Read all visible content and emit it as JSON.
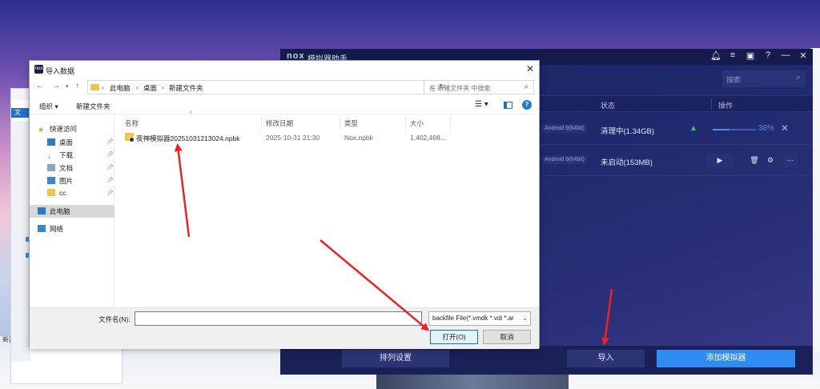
{
  "desktop": {
    "fragment_text": "新建"
  },
  "bg_explorer": {
    "tab_label": "文"
  },
  "nox": {
    "logo": "nox",
    "title": "模拟器助手",
    "title_icons": [
      "bell-icon",
      "menu-icon",
      "folder-icon",
      "help-icon",
      "minimize-icon",
      "close-icon"
    ],
    "search_placeholder": "搜索",
    "columns": {
      "status": "状态",
      "actions": "操作"
    },
    "rows": [
      {
        "android": "Android 9(64bit)",
        "status": "清理中(1.34GB)",
        "progress_percent": 38,
        "progress_label": "38%"
      },
      {
        "android": "Android 9(64bit)",
        "status": "未启动(153MB)",
        "actions": [
          "play-icon",
          "trash-icon",
          "gear-icon",
          "more-icon"
        ]
      }
    ],
    "buttons": {
      "sort": "排列设置",
      "import": "导入",
      "add": "添加模拟器"
    },
    "colors": {
      "accent": "#2f8cf2",
      "progress": "#4f8df0",
      "android": "#46c47a"
    }
  },
  "dialog": {
    "title": "导入数据",
    "breadcrumb": [
      "此电脑",
      "桌面",
      "新建文件夹"
    ],
    "search_placeholder": "在 新建文件夹 中搜索",
    "toolbar": {
      "organize": "组织 ▾",
      "new_folder": "新建文件夹"
    },
    "nav": {
      "quick_access": "快速访问",
      "items": [
        "桌面",
        "下载",
        "文档",
        "图片",
        "cc"
      ],
      "this_pc": "此电脑",
      "network": "网络"
    },
    "columns": {
      "name": "名称",
      "modified": "修改日期",
      "type": "类型",
      "size": "大小"
    },
    "files": [
      {
        "name": "夜神模拟器20251031213024.npbk",
        "modified": "2025-10-31 21:30",
        "type": "Nox.npbk",
        "size": "1,402,498..."
      }
    ],
    "filename_label": "文件名(N):",
    "filename_value": "",
    "filter": "backfile File(*.vmdk *.vdi *.ar",
    "open_button": "打开(O)",
    "cancel_button": "取消"
  }
}
